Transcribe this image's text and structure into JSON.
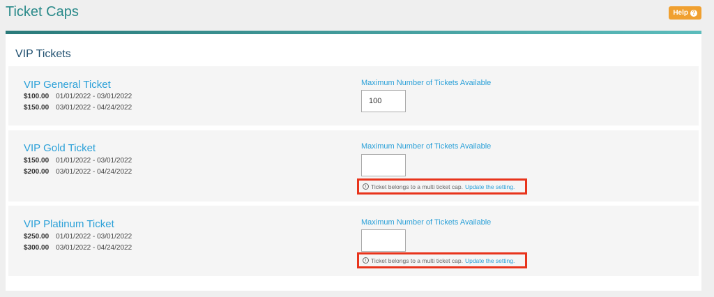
{
  "header": {
    "title": "Ticket Caps",
    "help_label": "Help"
  },
  "panel": {
    "title": "VIP Tickets"
  },
  "field_label": "Maximum Number of Tickets Available",
  "notice": {
    "text": "Ticket belongs to a multi ticket cap.",
    "link": "Update the setting."
  },
  "tickets": [
    {
      "name": "VIP General Ticket",
      "prices": [
        {
          "amount": "$100.00",
          "range": "01/01/2022 - 03/01/2022"
        },
        {
          "amount": "$150.00",
          "range": "03/01/2022 - 04/24/2022"
        }
      ],
      "max_value": "100"
    },
    {
      "name": "VIP Gold Ticket",
      "prices": [
        {
          "amount": "$150.00",
          "range": "01/01/2022 - 03/01/2022"
        },
        {
          "amount": "$200.00",
          "range": "03/01/2022 - 04/24/2022"
        }
      ],
      "max_value": ""
    },
    {
      "name": "VIP Platinum Ticket",
      "prices": [
        {
          "amount": "$250.00",
          "range": "01/01/2022 - 03/01/2022"
        },
        {
          "amount": "$300.00",
          "range": "03/01/2022 - 04/24/2022"
        }
      ],
      "max_value": ""
    }
  ]
}
